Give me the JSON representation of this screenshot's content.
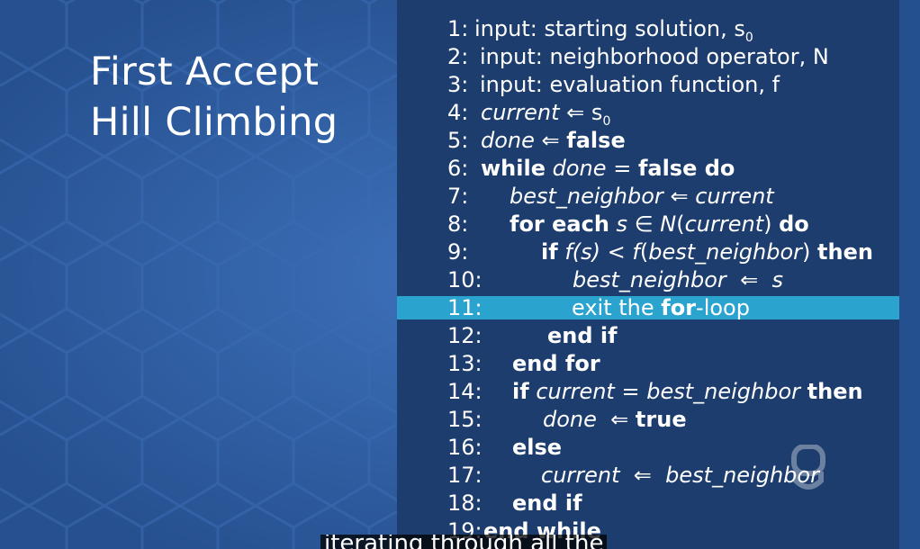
{
  "slide": {
    "title_line1": "First Accept",
    "title_line2": "Hill Climbing"
  },
  "code": [
    {
      "num": "1:",
      "text": "input: starting solution, s",
      "sub": "0"
    },
    {
      "num": "2:",
      "text": "input: neighborhood operator, N"
    },
    {
      "num": "3:",
      "text": "input: evaluation function, f"
    },
    {
      "num": "4:",
      "a": "current",
      "op": "⇐",
      "b": "s",
      "sub": "0"
    },
    {
      "num": "5:",
      "a": "done",
      "op": "⇐",
      "b": "false"
    },
    {
      "num": "6:",
      "w1": "while",
      "w2": "done",
      "w3": "=",
      "w4": "false do"
    },
    {
      "num": "7:",
      "a": "best_neighbor",
      "op": "⇐",
      "b": "current"
    },
    {
      "num": "8:",
      "w1": "for each",
      "w2": "s",
      "w3": "∈",
      "w4": "N",
      "w5": "(",
      "w6": "current",
      "w7": ")",
      "w8": "do"
    },
    {
      "num": "9:",
      "w1": "if",
      "w2": "f(s)",
      "w3": "<",
      "w4": "f",
      "w5": "(",
      "w6": "best_neighbor",
      "w7": ")",
      "w8": "then"
    },
    {
      "num": "10:",
      "a": "best_neighbor",
      "op": "⇐",
      "b": "s"
    },
    {
      "num": "11:",
      "t1": "exit the ",
      "t2": "for",
      "t3": "-loop"
    },
    {
      "num": "12:",
      "text": "end if"
    },
    {
      "num": "13:",
      "text": "end for"
    },
    {
      "num": "14:",
      "w1": "if",
      "w2": "current",
      "w3": "=",
      "w4": "best_neighbor",
      "w5": "then"
    },
    {
      "num": "15:",
      "a": "done",
      "op": "⇐",
      "b": "true"
    },
    {
      "num": "16:",
      "text": "else"
    },
    {
      "num": "17:",
      "a": "current",
      "op": "⇐",
      "b": "best_neighbor"
    },
    {
      "num": "18:",
      "text": "end if"
    },
    {
      "num": "19:",
      "text": "end while"
    }
  ],
  "highlight_line": "11:",
  "caption": "iterating through all the",
  "colors": {
    "background": "#2f5da3",
    "panel": "#1d3d6e",
    "highlight": "#2aa4cf"
  },
  "logo_icon": "ou-logo-icon"
}
